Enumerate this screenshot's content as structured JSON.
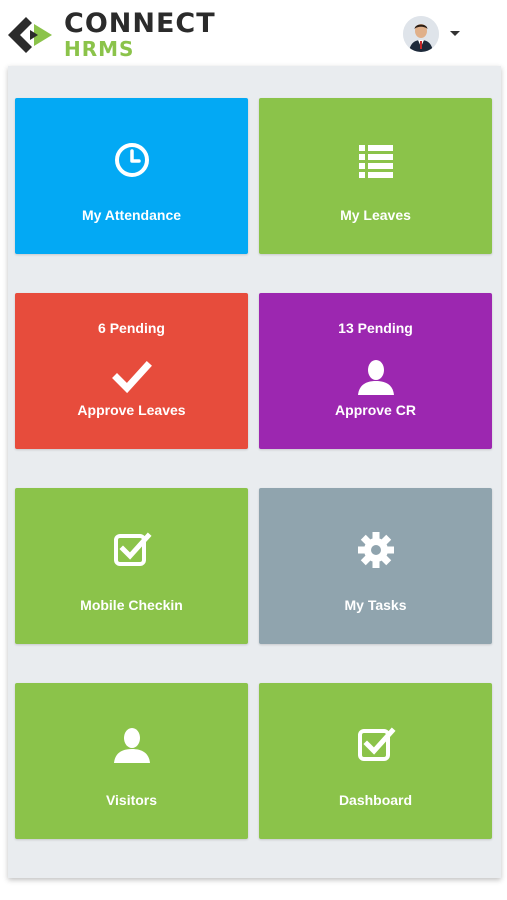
{
  "header": {
    "logo_connect": "CONNECT",
    "logo_hrms": "HRMS",
    "avatar_icon": "user-avatar",
    "caret_icon": "caret-down-icon"
  },
  "colors": {
    "blue": "#03a9f4",
    "green": "#8bc34a",
    "red": "#e74c3c",
    "purple": "#9c27b0",
    "gray": "#90a4ae",
    "panel": "#e9ecef"
  },
  "tiles": [
    {
      "label": "My Attendance",
      "icon": "clock-icon",
      "color": "#03a9f4"
    },
    {
      "label": "My Leaves",
      "icon": "list-icon",
      "color": "#8bc34a"
    },
    {
      "label": "Approve Leaves",
      "badge": "6 Pending",
      "icon": "check-icon",
      "color": "#e74c3c"
    },
    {
      "label": "Approve CR",
      "badge": "13 Pending",
      "icon": "user-icon",
      "color": "#9c27b0"
    },
    {
      "label": "Mobile Checkin",
      "icon": "checkbox-icon",
      "color": "#8bc34a"
    },
    {
      "label": "My Tasks",
      "icon": "gear-icon",
      "color": "#90a4ae"
    },
    {
      "label": "Visitors",
      "icon": "user-icon",
      "color": "#8bc34a"
    },
    {
      "label": "Dashboard",
      "icon": "checkbox-icon",
      "color": "#8bc34a"
    }
  ]
}
